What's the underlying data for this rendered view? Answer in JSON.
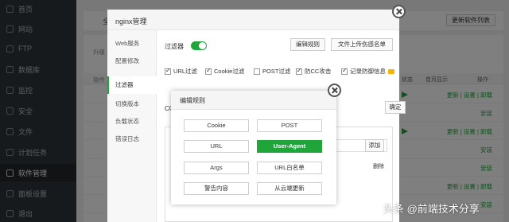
{
  "sidebar": {
    "items": [
      {
        "label": "首页"
      },
      {
        "label": "网站"
      },
      {
        "label": "FTP"
      },
      {
        "label": "数据库"
      },
      {
        "label": "监控"
      },
      {
        "label": "安全"
      },
      {
        "label": "文件"
      },
      {
        "label": "计划任务"
      },
      {
        "label": "软件管理",
        "active": true
      },
      {
        "label": "面板设置"
      },
      {
        "label": "退出"
      }
    ]
  },
  "background": {
    "header_text": "全",
    "update_button": "更新软件列表",
    "left_label_upgrade": "升级",
    "left_label_software": "软件",
    "status_col": "状态",
    "home_display_col": "首页显示",
    "ops_col": "操作",
    "row_links": "更新 | 设置 | 卸载",
    "install_link": "安装"
  },
  "nginx_dialog": {
    "title": "nginx管理",
    "menu": [
      "Web服务",
      "配置修改",
      "过滤器",
      "切换版本",
      "负载状态",
      "错误日志"
    ],
    "active_menu": "过滤器",
    "filter_label": "过滤器",
    "edit_rules_button": "编辑规则",
    "upload_button": "文件上传伤感名单",
    "checkboxes": [
      {
        "label": "URL过滤",
        "checked": true
      },
      {
        "label": "Cookie过滤",
        "checked": true
      },
      {
        "label": "POST过滤",
        "checked": false
      },
      {
        "label": "防CC攻击",
        "checked": true
      },
      {
        "label": "记录防御信息",
        "checked": true
      }
    ],
    "cc_label": "CC",
    "confirm_button": "确定",
    "add_button": "添加",
    "delete_link": "删除"
  },
  "edit_rules": {
    "title": "编辑规则",
    "buttons": [
      "Cookie",
      "POST",
      "URL",
      "User-Agent",
      "Args",
      "URL白名单",
      "警告内容",
      "从云端更新"
    ],
    "active": "User-Agent"
  },
  "watermark": "头条 @前端技术分享",
  "colors": {
    "accent": "#20a53a",
    "sidebar_bg": "#2f3439"
  }
}
